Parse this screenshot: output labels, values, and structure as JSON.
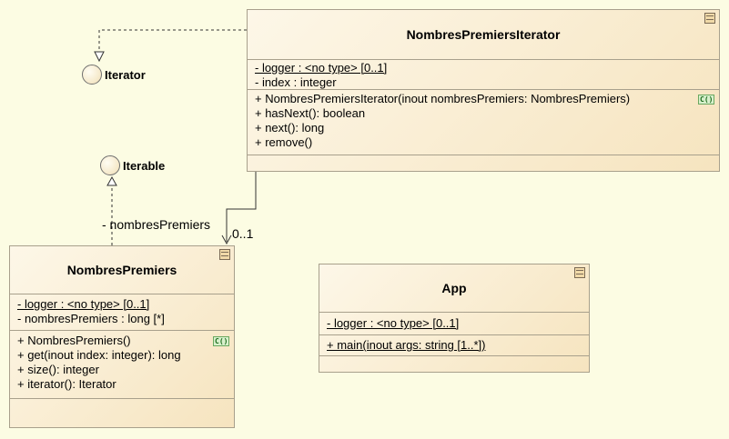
{
  "interfaces": {
    "iterator": {
      "label": "Iterator"
    },
    "iterable": {
      "label": "Iterable"
    }
  },
  "classes": {
    "nombres_premiers_iterator": {
      "name": "NombresPremiersIterator",
      "attributes": [
        {
          "text": "- logger : <no type> [0..1]",
          "static": true
        },
        {
          "text": "- index : integer",
          "static": false
        }
      ],
      "operations": [
        {
          "text": "+ NombresPremiersIterator(inout nombresPremiers: NombresPremiers)",
          "constructor": true
        },
        {
          "text": "+ hasNext(): boolean"
        },
        {
          "text": "+ next(): long"
        },
        {
          "text": "+ remove()"
        }
      ]
    },
    "nombres_premiers": {
      "name": "NombresPremiers",
      "attributes": [
        {
          "text": "- logger : <no type> [0..1]",
          "static": true
        },
        {
          "text": "- nombresPremiers : long [*]",
          "static": false
        }
      ],
      "operations": [
        {
          "text": "+ NombresPremiers()",
          "constructor": true
        },
        {
          "text": "+ get(inout index: integer): long"
        },
        {
          "text": "+ size(): integer"
        },
        {
          "text": "+ iterator(): Iterator"
        }
      ]
    },
    "app": {
      "name": "App",
      "attributes": [
        {
          "text": "- logger : <no type> [0..1]",
          "static": true
        }
      ],
      "operations": [
        {
          "text": "+ main(inout args: string [1..*])",
          "static": true
        }
      ]
    }
  },
  "association": {
    "role": "- nombresPremiers",
    "multiplicity": "0..1"
  },
  "badge": "C()",
  "colors": {
    "background": "#fcfce3",
    "class_border": "#a8a08c",
    "line": "#333333"
  }
}
